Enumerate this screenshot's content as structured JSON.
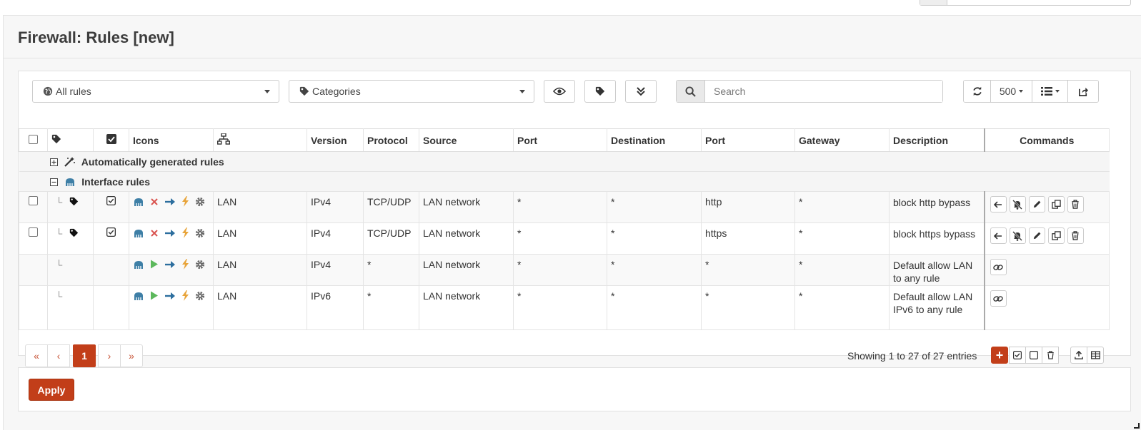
{
  "page": {
    "title": "Firewall: Rules [new]"
  },
  "toolbar": {
    "rules_filter": "All rules",
    "categories_filter": "Categories",
    "search_placeholder": "Search",
    "page_size": "500"
  },
  "table": {
    "headers": {
      "icons": "Icons",
      "version": "Version",
      "protocol": "Protocol",
      "source": "Source",
      "source_port": "Port",
      "destination": "Destination",
      "dest_port": "Port",
      "gateway": "Gateway",
      "description": "Description",
      "commands": "Commands"
    },
    "groups": {
      "auto": "Automatically generated rules",
      "interface": "Interface rules"
    },
    "rows": [
      {
        "iface": "LAN",
        "version": "IPv4",
        "protocol": "TCP/UDP",
        "source": "LAN network",
        "source_port": "*",
        "destination": "*",
        "dest_port": "http",
        "gateway": "*",
        "description": "block http bypass"
      },
      {
        "iface": "LAN",
        "version": "IPv4",
        "protocol": "TCP/UDP",
        "source": "LAN network",
        "source_port": "*",
        "destination": "*",
        "dest_port": "https",
        "gateway": "*",
        "description": "block https bypass"
      },
      {
        "iface": "LAN",
        "version": "IPv4",
        "protocol": "*",
        "source": "LAN network",
        "source_port": "*",
        "destination": "*",
        "dest_port": "*",
        "gateway": "*",
        "description": "Default allow LAN to any rule"
      },
      {
        "iface": "LAN",
        "version": "IPv6",
        "protocol": "*",
        "source": "LAN network",
        "source_port": "*",
        "destination": "*",
        "dest_port": "*",
        "gateway": "*",
        "description": "Default allow LAN IPv6 to any rule"
      }
    ]
  },
  "pagination": {
    "first": "«",
    "prev": "‹",
    "current": "1",
    "next": "›",
    "last": "»",
    "entries": "Showing 1 to 27 of 27 entries"
  },
  "footer": {
    "add_label": "+"
  },
  "apply": {
    "label": "Apply"
  },
  "colors": {
    "accent": "#c23e19",
    "nic_icon": "#3e7fa6",
    "block": "#d9534f",
    "pass": "#5cb85c",
    "arrow": "#2c6e9e",
    "bolt": "#e8a43a"
  }
}
